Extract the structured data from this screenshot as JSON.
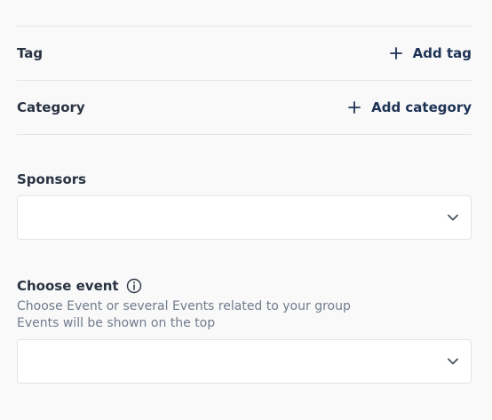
{
  "tag_row": {
    "label": "Tag",
    "action_label": "Add tag",
    "action_icon": "plus-icon"
  },
  "category_row": {
    "label": "Category",
    "action_label": "Add category",
    "action_icon": "plus-icon"
  },
  "sponsors": {
    "label": "Sponsors",
    "value": "",
    "dropdown_icon": "chevron-down-icon"
  },
  "choose_event": {
    "label": "Choose event",
    "info_icon": "info-icon",
    "help_line1": "Choose Event or several Events related to your group",
    "help_line2": "Events will be shown on the top",
    "value": "",
    "dropdown_icon": "chevron-down-icon"
  },
  "colors": {
    "background": "#f9f9fa",
    "accent": "#1d3254",
    "divider": "#e2e4e8",
    "muted_text": "#707b8a"
  }
}
